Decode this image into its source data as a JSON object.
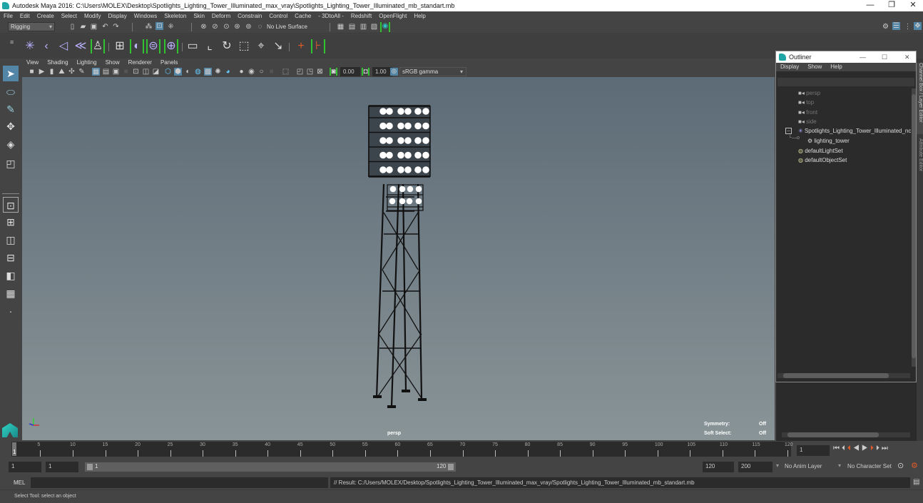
{
  "window": {
    "title": "Autodesk Maya 2016: C:\\Users\\MOLEX\\Desktop\\Spotlights_Lighting_Tower_Illuminated_max_vray\\Spotlights_Lighting_Tower_Illuminated_mb_standart.mb",
    "minimize": "—",
    "restore": "❐",
    "close": "✕"
  },
  "menubar": [
    "File",
    "Edit",
    "Create",
    "Select",
    "Modify",
    "Display",
    "Windows",
    "Skeleton",
    "Skin",
    "Deform",
    "Constrain",
    "Control",
    "Cache",
    "- 3DtoAll -",
    "Redshift",
    "OpenFlight",
    "Help"
  ],
  "statusline": {
    "menuset": "Rigging",
    "live_surface": "No Live Surface"
  },
  "viewport": {
    "menu": [
      "View",
      "Shading",
      "Lighting",
      "Show",
      "Renderer",
      "Panels"
    ],
    "exposure": "0.00",
    "gamma": "1.00",
    "colorspace": "sRGB gamma",
    "camera_label": "persp",
    "hud": [
      {
        "label": "Symmetry:",
        "value": "Off"
      },
      {
        "label": "Soft Select:",
        "value": "Off"
      }
    ]
  },
  "outliner": {
    "title": "Outliner",
    "menu": [
      "Display",
      "Show",
      "Help"
    ],
    "items": [
      {
        "label": "persp",
        "type": "camera",
        "dim": true
      },
      {
        "label": "top",
        "type": "camera",
        "dim": true
      },
      {
        "label": "front",
        "type": "camera",
        "dim": true
      },
      {
        "label": "side",
        "type": "camera",
        "dim": true
      },
      {
        "label": "Spotlights_Lighting_Tower_Illuminated_nc",
        "type": "group",
        "dim": false
      },
      {
        "label": "lighting_tower",
        "type": "mesh",
        "dim": false
      },
      {
        "label": "defaultLightSet",
        "type": "set",
        "dim": false
      },
      {
        "label": "defaultObjectSet",
        "type": "set",
        "dim": false
      }
    ]
  },
  "side_tabs": [
    "Channel Box / Layer Editor",
    "Attribute Editor"
  ],
  "timeline": {
    "ticks": [
      1,
      5,
      10,
      15,
      20,
      25,
      30,
      35,
      40,
      45,
      50,
      55,
      60,
      65,
      70,
      75,
      80,
      85,
      90,
      95,
      100,
      105,
      110,
      115,
      120
    ],
    "current_frame": "1",
    "current_time_field": "1"
  },
  "range": {
    "start": "1",
    "anim_start": "1",
    "slider_start": "1",
    "slider_end": "120",
    "anim_end": "120",
    "end": "200",
    "anim_layer": "No Anim Layer",
    "character_set": "No Character Set"
  },
  "cmdline": {
    "label": "MEL",
    "result": "// Result: C:/Users/MOLEX/Desktop/Spotlights_Lighting_Tower_Illuminated_max_vray/Spotlights_Lighting_Tower_Illuminated_mb_standart.mb"
  },
  "helpline": {
    "text": "Select Tool: select an object"
  },
  "colors": {
    "accent": "#5285a6",
    "highlight_green": "#2fc42f",
    "key_red": "#e05a2a"
  }
}
